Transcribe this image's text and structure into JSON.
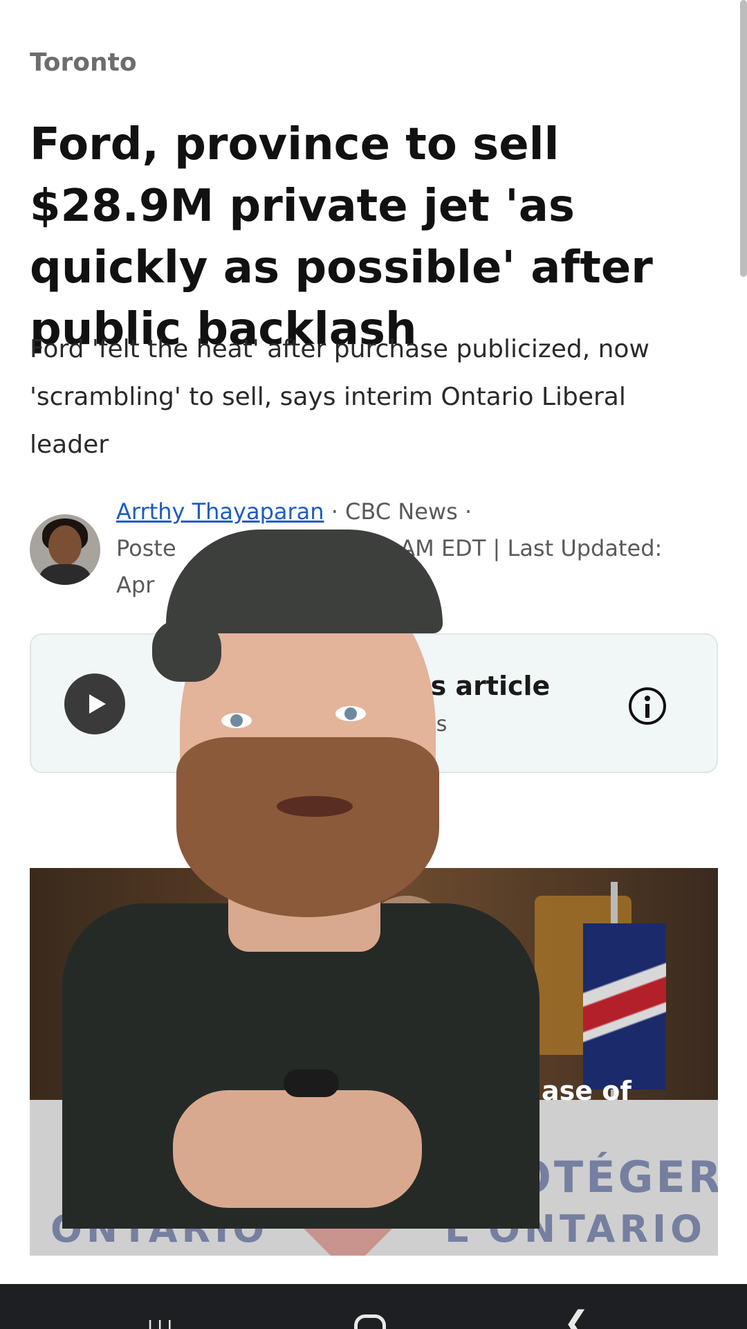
{
  "article": {
    "section": "Toronto",
    "headline": "Ford, province to sell $28.9M private jet 'as quickly as possible' after public backlash",
    "dek": "Ford 'felt the heat' after purchase publicized, now 'scrambling' to sell, says interim Ontario Liberal leader",
    "byline": {
      "author": "Arrthy Thayaparan",
      "outlet": " · CBC News ·",
      "posted_visible": "Poste",
      "posted_time_visible": "026 11:30 AM EDT | Last Updated:",
      "updated_visible": "Apr"
    }
  },
  "audio": {
    "title_visible": "o this article",
    "duration_visible": "minutes",
    "icons": {
      "play": "play-icon",
      "info": "info-icon"
    }
  },
  "hero": {
    "caption_visible": "ase of",
    "sign_text_left": "ONTARIO",
    "sign_text_right_1": "PROTÉGER",
    "sign_text_right_2": "L'ONTARIO"
  },
  "navbar": {
    "recent_glyph": "|||",
    "back_glyph": "❮"
  },
  "colors": {
    "link": "#1d5cc4",
    "audio_bg": "#f1f6f6",
    "navbar_bg": "#1e1f22"
  }
}
